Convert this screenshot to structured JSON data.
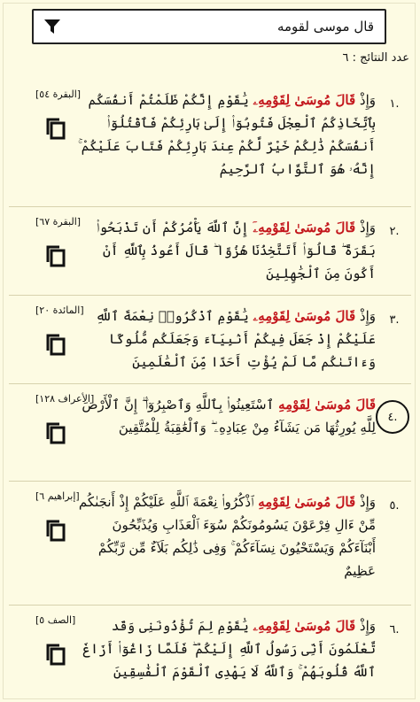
{
  "search": {
    "query": "قال موسى لقومه",
    "filter_icon": "filter-funnel-icon"
  },
  "result_count": "عدد النتائج : ٦",
  "results": [
    {
      "number": "١.",
      "ref": "[البقرة ٥٤]",
      "pre": "وَإِذْ ",
      "highlight": "قَالَ مُوسَىٰ لِقَوْمِهِۦ",
      "post": " يَٰقَوْمِ إِنَّكُمْ ظَلَمْتُمْ أَنفُسَكُم بِٱتِّخَاذِكُمُ ٱلْعِجْلَ فَتُوبُوٓا۟ إِلَىٰ بَارِئِكُمْ فَٱقْتُلُوٓا۟ أَنفُسَكُمْ ذَٰلِكُمْ خَيْرٌ لَّكُمْ عِندَ بَارِئِكُمْ فَتَابَ عَلَيْكُمْ ۚ إِنَّهُۥ هُوَ ٱلتَّوَّابُ ٱلرَّحِيمُ"
    },
    {
      "number": "٢.",
      "ref": "[البقرة ٦٧]",
      "pre": "وَإِذْ ",
      "highlight": "قَالَ مُوسَىٰ لِقَوْمِهِۦٓ",
      "post": " إِنَّ ٱللَّهَ يَأْمُرُكُمْ أَن تَذْبَحُوا۟ بَقَرَةً ۖ قَالُوٓا۟ أَتَتَّخِذُنَا هُزُوًا ۖ قَالَ أَعُوذُ بِٱللَّهِ أَنْ أَكُونَ مِنَ ٱلْجَٰهِلِينَ"
    },
    {
      "number": "٣.",
      "ref": "[المائدة ٢٠]",
      "pre": "وَإِذْ ",
      "highlight": "قَالَ مُوسَىٰ لِقَوْمِهِۦ",
      "post": " يَٰقَوْمِ ٱذْكُرُوا۟ نِعْمَةَ ٱللَّهِ عَلَيْكُمْ إِذْ جَعَلَ فِيكُمْ أَنۢبِيَآءَ وَجَعَلَكُم مُّلُوكًا وَءَاتَىٰكُم مَّا لَمْ يُؤْتِ أَحَدًا مِّنَ ٱلْعَٰلَمِينَ"
    },
    {
      "number": "٤.",
      "ref": "[الأعراف ١٢٨]",
      "pre": "",
      "highlight": "قَالَ مُوسَىٰ لِقَوْمِهِ",
      "post": " ٱسْتَعِينُوا۟ بِٱللَّهِ وَٱصْبِرُوٓا۟ ۖ إِنَّ ٱلْأَرْضَ لِلَّهِ يُورِثُهَا مَن يَشَآءُ مِنْ عِبَادِهِۦ ۖ وَٱلْعَٰقِبَةُ لِلْمُتَّقِينَ",
      "circled": true
    },
    {
      "number": "٥.",
      "ref": "[إبراهيم ٦]",
      "pre": "وَإِذْ ",
      "highlight": "قَالَ مُوسَىٰ لِقَوْمِهِ",
      "post": " ٱذْكُرُوا۟ نِعْمَةَ ٱللَّهِ عَلَيْكُمْ إِذْ أَنجَىٰكُم مِّنْ ءَالِ فِرْعَوْنَ يَسُومُونَكُمْ سُوٓءَ ٱلْعَذَابِ وَيُذَبِّحُونَ أَبْنَآءَكُمْ وَيَسْتَحْيُونَ نِسَآءَكُمْ ۚ وَفِى ذَٰلِكُم بَلَآءٌ مِّن رَّبِّكُمْ عَظِيمٌ"
    },
    {
      "number": "٦.",
      "ref": "[الصف ٥]",
      "pre": "وَإِذْ ",
      "highlight": "قَالَ مُوسَىٰ لِقَوْمِهِۦ",
      "post": " يَٰقَوْمِ لِمَ تُؤْذُونَنِى وَقَد تَّعْلَمُونَ أَنِّى رَسُولُ ٱللَّهِ إِلَيْكُمْ ۖ فَلَمَّا زَاغُوٓا۟ أَزَاغَ ٱللَّهُ قُلُوبَهُمْ ۚ وَٱللَّهُ لَا يَهْدِى ٱلْقَوْمَ ٱلْفَٰسِقِينَ"
    }
  ],
  "colors": {
    "background": "#fdfbe3",
    "highlight": "#c3161c",
    "divider": "#d7d2ad"
  }
}
